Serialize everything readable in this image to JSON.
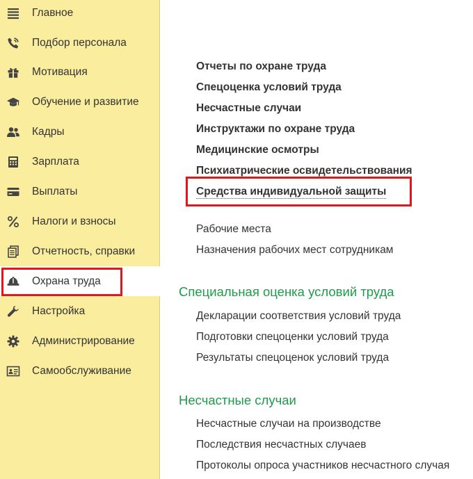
{
  "sidebar": {
    "items": [
      {
        "label": "Главное",
        "icon": "menu-lines-icon"
      },
      {
        "label": "Подбор персонала",
        "icon": "phone-icon"
      },
      {
        "label": "Мотивация",
        "icon": "gift-icon"
      },
      {
        "label": "Обучение и развитие",
        "icon": "graduation-cap-icon"
      },
      {
        "label": "Кадры",
        "icon": "people-icon"
      },
      {
        "label": "Зарплата",
        "icon": "calculator-icon"
      },
      {
        "label": "Выплаты",
        "icon": "card-icon"
      },
      {
        "label": "Налоги и взносы",
        "icon": "percent-icon"
      },
      {
        "label": "Отчетность, справки",
        "icon": "documents-icon"
      },
      {
        "label": "Охрана труда",
        "icon": "hard-hat-icon"
      },
      {
        "label": "Настройка",
        "icon": "wrench-icon"
      },
      {
        "label": "Администрирование",
        "icon": "gear-icon"
      },
      {
        "label": "Самообслуживание",
        "icon": "id-card-icon"
      }
    ],
    "active_index": 9
  },
  "main": {
    "primary_links": [
      "Отчеты по охране труда",
      "Спецоценка условий труда",
      "Несчастные случаи",
      "Инструктажи по охране труда",
      "Медицинские осмотры",
      "Психиатрические освидетельствования",
      "Средства индивидуальной защиты"
    ],
    "secondary_links": [
      "Рабочие места",
      "Назначения рабочих мест сотрудникам"
    ],
    "sections": [
      {
        "title": "Специальная оценка условий труда",
        "links": [
          "Декларации соответствия условий труда",
          "Подготовки спецоценки условий труда",
          "Результаты спецоценок условий труда"
        ]
      },
      {
        "title": "Несчастные случаи",
        "links": [
          "Несчастные случаи на производстве",
          "Последствия несчастных случаев",
          "Протоколы опроса участников несчастного случая"
        ]
      }
    ]
  },
  "colors": {
    "sidebar_bg": "#fbed9e",
    "highlight_border": "#e8141b",
    "section_title": "#1f9a4b",
    "text": "#333333"
  }
}
